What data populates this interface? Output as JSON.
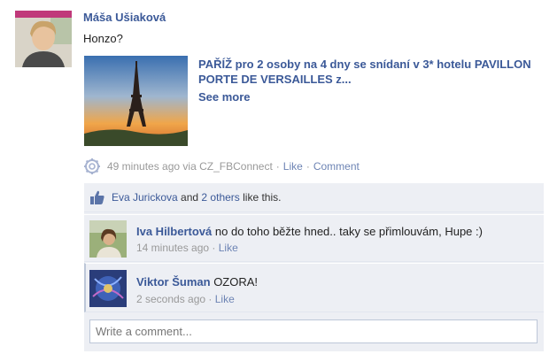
{
  "post": {
    "author": "Máša Ušiaková",
    "message": "Honzo?",
    "attachment": {
      "title": "PAŘÍŽ pro 2 osoby na 4 dny se snídaní v 3* hotelu PAVILLON PORTE DE VERSAILLES z...",
      "see_more": "See more",
      "thumbnail_icon": "eiffel-tower-photo"
    },
    "meta": {
      "time": "49 minutes ago",
      "via_label": "via",
      "app": "CZ_FBConnect",
      "separator": "·",
      "like": "Like",
      "comment": "Comment",
      "app_icon": "gear-app-icon"
    }
  },
  "likes": {
    "liker": "Eva Jurickova",
    "and": "and",
    "others": "2 others",
    "suffix": "like this.",
    "icon": "thumbs-up-icon"
  },
  "comments": [
    {
      "author": "Iva Hilbertová",
      "text": "no do toho běžte hned.. taky se přimlouvám, Hupe :)",
      "time": "14 minutes ago",
      "like": "Like"
    },
    {
      "author": "Viktor Šuman",
      "text": "OZORA!",
      "time": "2 seconds ago",
      "like": "Like"
    }
  ],
  "composer": {
    "placeholder": "Write a comment..."
  },
  "colors": {
    "link": "#3b5998",
    "meta_link": "#6d84b4",
    "ufi_background": "#edeff4",
    "muted_text": "#999999"
  }
}
